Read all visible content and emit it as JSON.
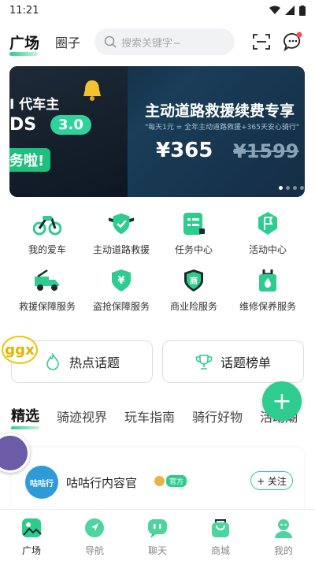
{
  "status_bar": {
    "time": "11:21"
  },
  "header": {
    "tab_active": "广场",
    "tab_other": "圈子",
    "search_placeholder": "搜索关键字~"
  },
  "banner": {
    "left_line1": "I 代车主",
    "left_line2": "DS",
    "left_badge": "3.0",
    "left_line3": "务啦!",
    "title": "主动道路救援续费专享",
    "subtitle": "\"每天1元 = 全年主动道路救援+365天安心骑行\"",
    "price": "¥365",
    "old_price": "¥1599",
    "slide_count": 4,
    "active_slide": 1
  },
  "services": [
    {
      "label": "我的爱车",
      "icon": "motorcycle-icon"
    },
    {
      "label": "主动道路救援",
      "icon": "shield-wings-icon"
    },
    {
      "label": "任务中心",
      "icon": "task-list-icon"
    },
    {
      "label": "活动中心",
      "icon": "flag-icon"
    },
    {
      "label": "救援保障服务",
      "icon": "tow-truck-icon"
    },
    {
      "label": "盗抢保障服务",
      "icon": "yuan-shield-icon"
    },
    {
      "label": "商业险服务",
      "icon": "commerce-shield-icon"
    },
    {
      "label": "维修保养服务",
      "icon": "maintenance-icon"
    }
  ],
  "topics": {
    "hot": "热点话题",
    "ranking": "话题榜单"
  },
  "float_logo": "ggx",
  "fab_label": "+",
  "categories": [
    "精选",
    "骑迹视界",
    "玩车指南",
    "骑行好物",
    "活动潮"
  ],
  "post": {
    "avatar_text": "咕咕行",
    "name": "咕咕行内容官",
    "badge": "官方",
    "follow": "+ 关注"
  },
  "bottom_nav": [
    {
      "label": "广场",
      "active": true
    },
    {
      "label": "导航",
      "active": false
    },
    {
      "label": "聊天",
      "active": false
    },
    {
      "label": "商城",
      "active": false
    },
    {
      "label": "我的",
      "active": false
    }
  ],
  "colors": {
    "accent": "#2ecc8f",
    "notify": "#ff4d4f"
  }
}
